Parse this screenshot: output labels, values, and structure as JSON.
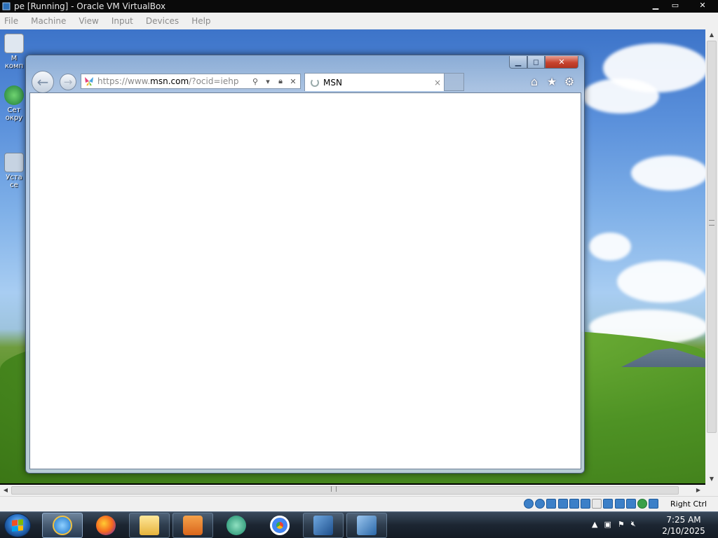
{
  "host": {
    "title": "pe [Running] - Oracle VM VirtualBox",
    "menu": [
      "File",
      "Machine",
      "View",
      "Input",
      "Devices",
      "Help"
    ],
    "host_key": "Right Ctrl"
  },
  "desktop": {
    "icons": [
      {
        "label": "М\nкомп",
        "icon": "computer-icon"
      },
      {
        "label": "Сет\nокру",
        "icon": "network-icon"
      },
      {
        "label": "Уста\nсе",
        "icon": "install-icon"
      }
    ]
  },
  "browser": {
    "url_prefix": "https://www.",
    "url_domain": "msn.com",
    "url_suffix": "/?ocid=iehp",
    "tab_title": "MSN",
    "tab_close": "×",
    "toolbar_icons": [
      "home-icon",
      "favorites-star-icon",
      "settings-gear-icon"
    ]
  },
  "taskbar": {
    "apps": [
      {
        "name": "Internet Explorer",
        "icon": "internet-explorer-icon",
        "state": "active"
      },
      {
        "name": "Firefox",
        "icon": "firefox-icon",
        "state": "pinned"
      },
      {
        "name": "Windows Explorer",
        "icon": "folder-icon",
        "state": "running"
      },
      {
        "name": "Media Player",
        "icon": "media-player-icon",
        "state": "running"
      },
      {
        "name": "Network",
        "icon": "network-globe-icon",
        "state": "pinned"
      },
      {
        "name": "Chrome",
        "icon": "chrome-icon",
        "state": "pinned"
      },
      {
        "name": "VirtualBox",
        "icon": "virtualbox-icon",
        "state": "running"
      },
      {
        "name": "Windows 7 x64",
        "icon": "win7-64-icon",
        "state": "running"
      }
    ],
    "time": "7:25 AM",
    "date": "2/10/2025"
  },
  "colors": {
    "ie_frame": "#c4d4e8",
    "close_button": "#c7432e",
    "taskbar": "#1c2632"
  }
}
